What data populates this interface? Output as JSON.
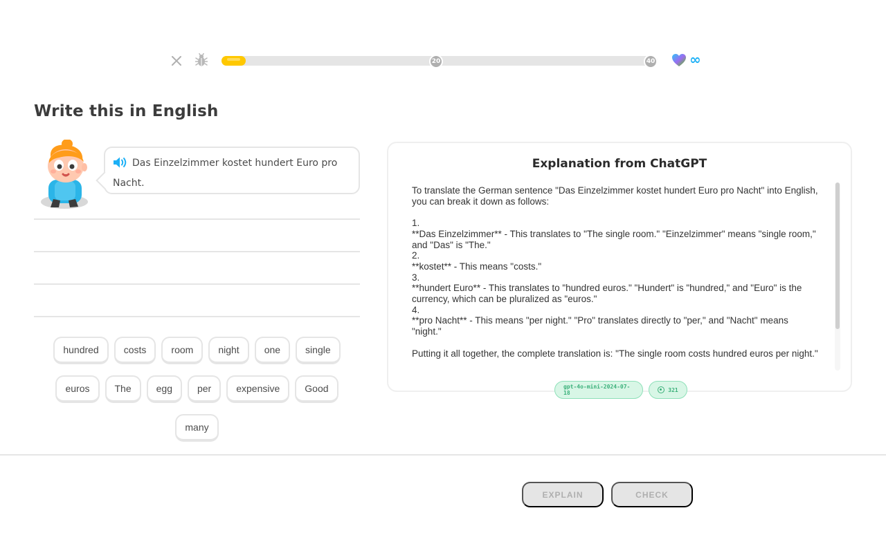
{
  "header": {
    "close_icon": "close-icon",
    "bug_icon": "bug-icon",
    "progress": {
      "fraction": 0.055,
      "milestones": [
        "20",
        "40"
      ]
    },
    "hearts_icon": "heart-icon",
    "hearts_value": "∞"
  },
  "challenge": {
    "title": "Write this in English",
    "prompt_sentence": "Das Einzelzimmer kostet hundert Euro pro Nacht.",
    "speaker_icon": "speaker-icon"
  },
  "word_bank": {
    "row1": [
      "hundred",
      "costs",
      "room",
      "night",
      "one",
      "single"
    ],
    "row2": [
      "euros",
      "The",
      "egg",
      "per",
      "expensive",
      "Good"
    ],
    "row3": [
      "many"
    ]
  },
  "explanation": {
    "title": "Explanation from ChatGPT",
    "body": "To translate the German sentence \"Das Einzelzimmer kostet hundert Euro pro Nacht\" into English, you can break it down as follows:\n\n1.\n**Das Einzelzimmer** - This translates to \"The single room.\" \"Einzelzimmer\" means \"single room,\" and \"Das\" is \"The.\"\n2.\n**kostet** - This means \"costs.\"\n3.\n**hundert Euro** - This translates to \"hundred euros.\" \"Hundert\" is \"hundred,\" and \"Euro\" is the currency, which can be pluralized as \"euros.\"\n4.\n**pro Nacht** - This means \"per night.\" \"Pro\" translates directly to \"per,\" and \"Nacht\" means \"night.\"\n\nPutting it all together, the complete translation is: \"The single room costs hundred euros per night.\"",
    "model_badge": "gpt-4o-mini-2024-07-18",
    "token_badge": "321"
  },
  "footer": {
    "explain_label": "EXPLAIN",
    "check_label": "CHECK"
  },
  "colors": {
    "progress_fill": "#ffc800",
    "accent_blue": "#1cb0f6",
    "badge_green": "#3bb07a",
    "disabled_button": "#e5e5e5"
  }
}
